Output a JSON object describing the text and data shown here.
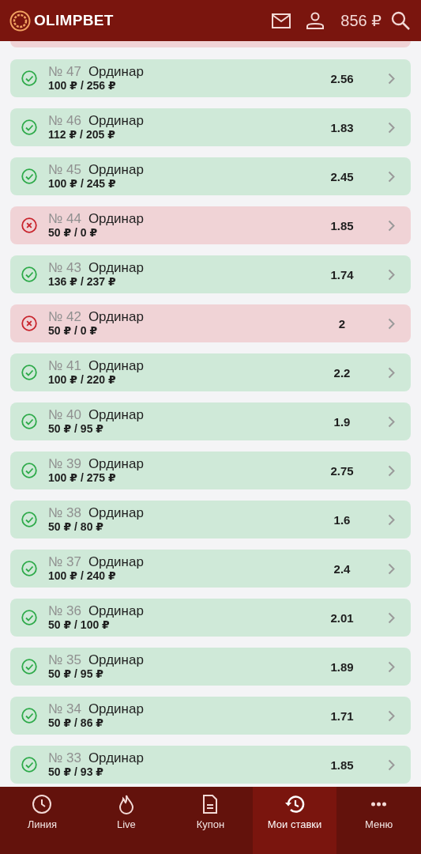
{
  "header": {
    "logo": "OLIMPBET",
    "balance": "856 ₽"
  },
  "bets": [
    {
      "number": "№ 47",
      "type": "Ординар",
      "amounts": "100 ₽ / 256 ₽",
      "odds": "2.56",
      "kind": "won"
    },
    {
      "number": "№ 46",
      "type": "Ординар",
      "amounts": "112 ₽ / 205 ₽",
      "odds": "1.83",
      "kind": "won"
    },
    {
      "number": "№ 45",
      "type": "Ординар",
      "amounts": "100 ₽ / 245 ₽",
      "odds": "2.45",
      "kind": "won"
    },
    {
      "number": "№ 44",
      "type": "Ординар",
      "amounts": "50 ₽ / 0 ₽",
      "odds": "1.85",
      "kind": "lost"
    },
    {
      "number": "№ 43",
      "type": "Ординар",
      "amounts": "136 ₽ / 237 ₽",
      "odds": "1.74",
      "kind": "won"
    },
    {
      "number": "№ 42",
      "type": "Ординар",
      "amounts": "50 ₽ / 0 ₽",
      "odds": "2",
      "kind": "lost"
    },
    {
      "number": "№ 41",
      "type": "Ординар",
      "amounts": "100 ₽ / 220 ₽",
      "odds": "2.2",
      "kind": "won"
    },
    {
      "number": "№ 40",
      "type": "Ординар",
      "amounts": "50 ₽ / 95 ₽",
      "odds": "1.9",
      "kind": "won"
    },
    {
      "number": "№ 39",
      "type": "Ординар",
      "amounts": "100 ₽ / 275 ₽",
      "odds": "2.75",
      "kind": "won"
    },
    {
      "number": "№ 38",
      "type": "Ординар",
      "amounts": "50 ₽ / 80 ₽",
      "odds": "1.6",
      "kind": "won"
    },
    {
      "number": "№ 37",
      "type": "Ординар",
      "amounts": "100 ₽ / 240 ₽",
      "odds": "2.4",
      "kind": "won"
    },
    {
      "number": "№ 36",
      "type": "Ординар",
      "amounts": "50 ₽ / 100 ₽",
      "odds": "2.01",
      "kind": "won"
    },
    {
      "number": "№ 35",
      "type": "Ординар",
      "amounts": "50 ₽ / 95 ₽",
      "odds": "1.89",
      "kind": "won"
    },
    {
      "number": "№ 34",
      "type": "Ординар",
      "amounts": "50 ₽ / 86 ₽",
      "odds": "1.71",
      "kind": "won"
    },
    {
      "number": "№ 33",
      "type": "Ординар",
      "amounts": "50 ₽ / 93 ₽",
      "odds": "1.85",
      "kind": "won"
    }
  ],
  "nav": [
    {
      "label": "Линия",
      "kind": "clock",
      "selected": false
    },
    {
      "label": "Live",
      "kind": "flame",
      "selected": false
    },
    {
      "label": "Купон",
      "kind": "document",
      "selected": false
    },
    {
      "label": "Мои ставки",
      "kind": "history",
      "selected": true
    },
    {
      "label": "Меню",
      "kind": "dots",
      "selected": false
    }
  ]
}
